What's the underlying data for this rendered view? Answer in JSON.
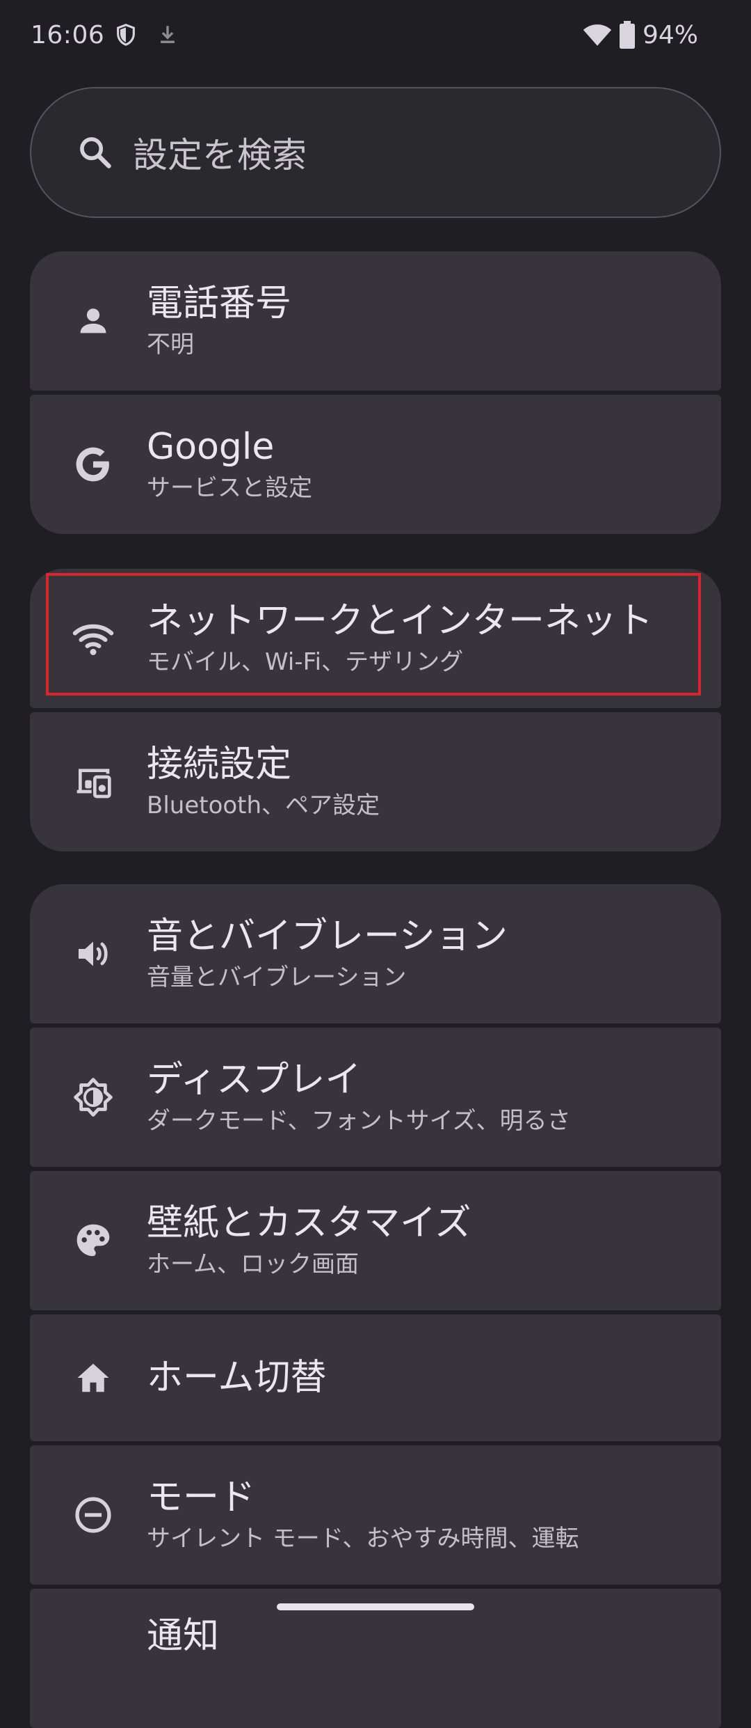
{
  "status_bar": {
    "time": "16:06",
    "battery": "94%",
    "icons": [
      "shield-icon",
      "download-icon",
      "wifi-icon",
      "battery-icon"
    ]
  },
  "search": {
    "placeholder": "設定を検索"
  },
  "items": [
    {
      "title": "電話番号",
      "subtitle": "不明",
      "icon": "person-icon"
    },
    {
      "title": "Google",
      "subtitle": "サービスと設定",
      "icon": "google-icon"
    },
    {
      "title": "ネットワークとインターネット",
      "subtitle": "モバイル、Wi-Fi、テザリング",
      "icon": "wifi-icon"
    },
    {
      "title": "接続設定",
      "subtitle": "Bluetooth、ペア設定",
      "icon": "connected-devices-icon"
    },
    {
      "title": "音とバイブレーション",
      "subtitle": "音量とバイブレーション",
      "icon": "volume-icon"
    },
    {
      "title": "ディスプレイ",
      "subtitle": "ダークモード、フォントサイズ、明るさ",
      "icon": "brightness-icon"
    },
    {
      "title": "壁紙とカスタマイズ",
      "subtitle": "ホーム、ロック画面",
      "icon": "palette-icon"
    },
    {
      "title": "ホーム切替",
      "subtitle": "",
      "icon": "home-icon"
    },
    {
      "title": "モード",
      "subtitle": "サイレント モード、おやすみ時間、運転",
      "icon": "do-not-disturb-icon"
    },
    {
      "title": "通知",
      "subtitle": "",
      "icon": "notifications-icon"
    }
  ],
  "colors": {
    "background": "#1f1e23",
    "card": "#37353b",
    "highlight": "#d9252e"
  }
}
